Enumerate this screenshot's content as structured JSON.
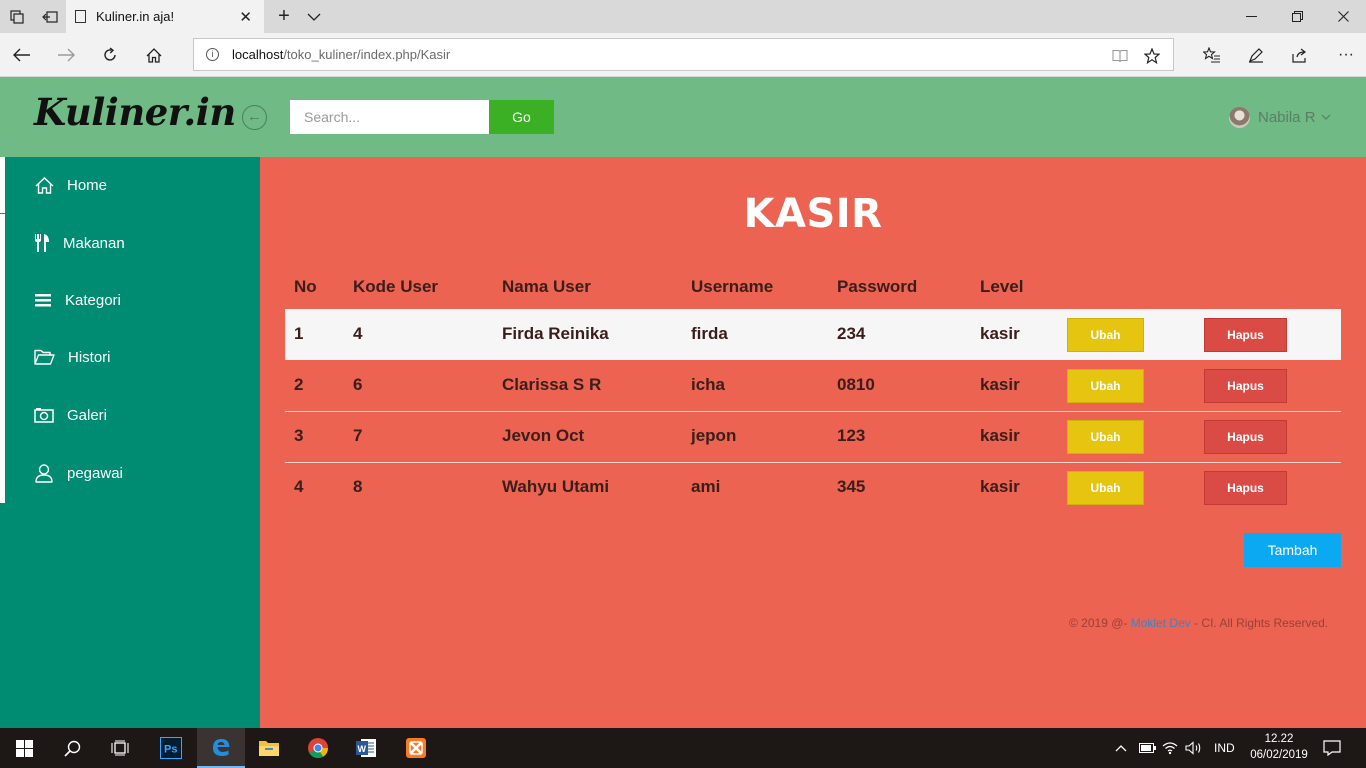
{
  "browser": {
    "tab_title": "Kuliner.in aja!",
    "url_host": "localhost",
    "url_path": "/toko_kuliner/index.php/Kasir"
  },
  "header": {
    "logo": "Kuliner.in",
    "search_placeholder": "Search...",
    "go_label": "Go",
    "user_name": "Nabila R"
  },
  "sidebar": {
    "items": [
      {
        "label": "Home",
        "icon": "home-icon"
      },
      {
        "label": "Makanan",
        "icon": "cutlery-icon"
      },
      {
        "label": "Kategori",
        "icon": "list-icon"
      },
      {
        "label": "Histori",
        "icon": "folder-open-icon"
      },
      {
        "label": "Galeri",
        "icon": "camera-icon"
      },
      {
        "label": "pegawai",
        "icon": "user-icon"
      }
    ]
  },
  "main": {
    "title": "KASIR",
    "columns": [
      "No",
      "Kode User",
      "Nama User",
      "Username",
      "Password",
      "Level"
    ],
    "rows": [
      {
        "no": "1",
        "kode": "4",
        "nama": "Firda Reinika",
        "username": "firda",
        "password": "234",
        "level": "kasir"
      },
      {
        "no": "2",
        "kode": "6",
        "nama": "Clarissa S R",
        "username": "icha",
        "password": "0810",
        "level": "kasir"
      },
      {
        "no": "3",
        "kode": "7",
        "nama": "Jevon Oct",
        "username": "jepon",
        "password": "123",
        "level": "kasir"
      },
      {
        "no": "4",
        "kode": "8",
        "nama": "Wahyu Utami",
        "username": "ami",
        "password": "345",
        "level": "kasir"
      }
    ],
    "edit_label": "Ubah",
    "delete_label": "Hapus",
    "add_label": "Tambah",
    "footer_prefix": "© 2019 @- ",
    "footer_link": "Moklet Dev",
    "footer_suffix": " - CI. All Rights Reserved."
  },
  "taskbar": {
    "language": "IND",
    "time": "12.22",
    "date": "06/02/2019"
  },
  "colors": {
    "header_bg": "#6fba85",
    "sidebar_bg": "#008b73",
    "main_bg": "#ec6351",
    "go_button": "#3bb024",
    "edit_button": "#e6c510",
    "delete_button": "#db4b46",
    "add_button": "#0aa9f2"
  }
}
